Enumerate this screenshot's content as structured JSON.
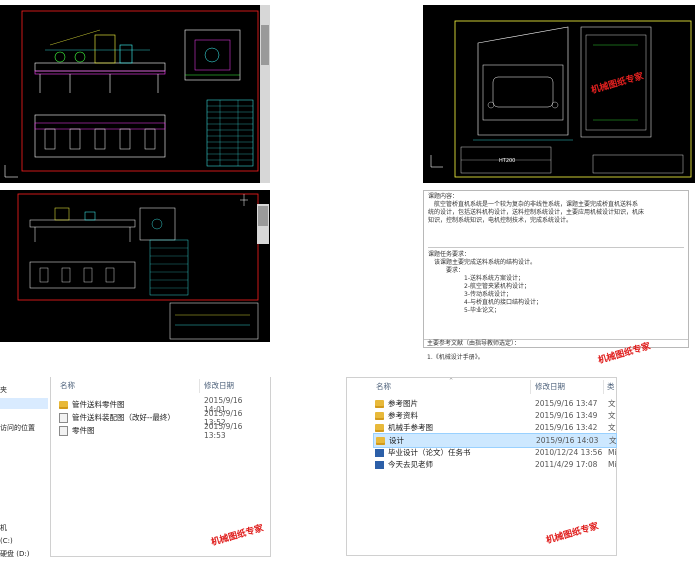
{
  "cad": {
    "dims_label": "HT200"
  },
  "task_doc": {
    "section1_title": "课题内容：",
    "section1_body_1": "航空管桥直机系统是一个较为复杂的非线性系统，课题主要完成桥直机送料系",
    "section1_body_2": "统的设计，包括送料机构设计，送料控制系统设计，主要应用机械设计知识，机床",
    "section1_body_3": "知识，控制系统知识，电机控制技术，完成系统设计。",
    "section2_title": "课题任务要求：",
    "section2_intro": "该课题主要完成送料系统的结构设计。",
    "section2_sub": "要求：",
    "reqs": [
      "1-送料系统方案设计；",
      "2-航空管夹紧机构设计；",
      "3-传动系统设计；",
      "4-与桥直机的接口结构设计；",
      "5-毕业论文；"
    ],
    "section3_title": "主要参考文献（由指导教师选定）：",
    "ref1": "1.《机械设计手册》。"
  },
  "explorer_left": {
    "col_name": "名称",
    "col_date": "修改日期",
    "sidebar": [
      "夹",
      "",
      "访问的位置",
      "",
      "",
      "",
      "",
      "",
      "机",
      "(C:)",
      "硬盘 (D:)"
    ],
    "files": [
      {
        "name": "管件送料零件图",
        "date": "2015/9/16 14:01",
        "kind": "folder"
      },
      {
        "name": "管件送料装配图（改好--最终）",
        "date": "2015/9/16 13:52",
        "kind": "file"
      },
      {
        "name": "零件图",
        "date": "2015/9/16 13:53",
        "kind": "file"
      }
    ]
  },
  "explorer_right": {
    "col_name": "名称",
    "col_date": "修改日期",
    "col_type": "类",
    "files": [
      {
        "name": "参考图片",
        "date": "2015/9/16 13:47",
        "type": "文",
        "kind": "folder"
      },
      {
        "name": "参考资料",
        "date": "2015/9/16 13:49",
        "type": "文",
        "kind": "folder"
      },
      {
        "name": "机械手参考图",
        "date": "2015/9/16 13:42",
        "type": "文",
        "kind": "folder"
      },
      {
        "name": "设计",
        "date": "2015/9/16 14:03",
        "type": "文",
        "kind": "folder"
      },
      {
        "name": "毕业设计（论文）任务书",
        "date": "2010/12/24 13:56",
        "type": "Mi",
        "kind": "word"
      },
      {
        "name": "今天去见老师",
        "date": "2011/4/29 17:08",
        "type": "Mi",
        "kind": "word"
      }
    ]
  },
  "watermarks": [
    "机械图纸专家",
    "机械图纸专家",
    "机械图纸专家",
    "机械图纸专家"
  ]
}
